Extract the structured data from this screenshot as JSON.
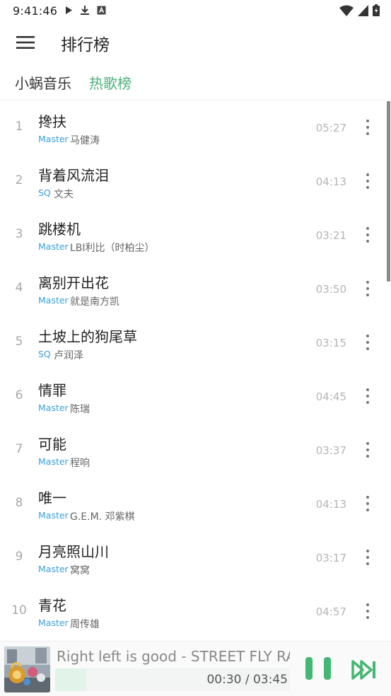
{
  "status": {
    "time": "9:41:46",
    "left_icons": [
      "play-icon",
      "download-icon",
      "a-badge-icon"
    ],
    "right_icons": [
      "wifi-icon",
      "signal-icon",
      "battery-icon"
    ]
  },
  "header": {
    "title": "排行榜",
    "menu_icon": "menu-icon"
  },
  "tabs": [
    {
      "label": "小蜗音乐",
      "active": false
    },
    {
      "label": "热歌榜",
      "active": true
    }
  ],
  "colors": {
    "accent": "#4caf7a",
    "quality": "#3a9ed8",
    "play": "#43b773"
  },
  "songs": [
    {
      "rank": "1",
      "title": "搀扶",
      "quality": "Master",
      "artist": "马健涛",
      "duration": "05:27"
    },
    {
      "rank": "2",
      "title": "背着风流泪",
      "quality": "SQ",
      "artist": "文夫",
      "duration": "04:13"
    },
    {
      "rank": "3",
      "title": "跳楼机",
      "quality": "Master",
      "artist": "LBI利比（时柏尘）",
      "duration": "03:21"
    },
    {
      "rank": "4",
      "title": "离别开出花",
      "quality": "Master",
      "artist": "就是南方凯",
      "duration": "03:50"
    },
    {
      "rank": "5",
      "title": "土坡上的狗尾草",
      "quality": "SQ",
      "artist": "卢润泽",
      "duration": "03:15"
    },
    {
      "rank": "6",
      "title": "情罪",
      "quality": "Master",
      "artist": "陈瑞",
      "duration": "04:45"
    },
    {
      "rank": "7",
      "title": "可能",
      "quality": "Master",
      "artist": "程响",
      "duration": "03:37"
    },
    {
      "rank": "8",
      "title": "唯一",
      "quality": "Master",
      "artist": "G.E.M. 邓紫棋",
      "duration": "04:13"
    },
    {
      "rank": "9",
      "title": "月亮照山川",
      "quality": "Master",
      "artist": "窝窝",
      "duration": "03:17"
    },
    {
      "rank": "10",
      "title": "青花",
      "quality": "Master",
      "artist": "周传雄",
      "duration": "04:57"
    }
  ],
  "player": {
    "title": "Right left is good - STREET FLY RA...",
    "progress_text": "00:30 / 03:45",
    "progress": 0.133,
    "pause_icon": "pause-icon",
    "next_icon": "skip-next-icon"
  }
}
